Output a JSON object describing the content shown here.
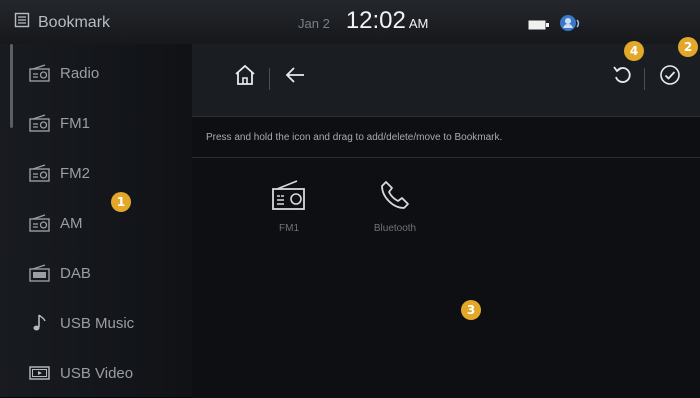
{
  "status_bar": {
    "app_title": "Bookmark",
    "app_icon": "bookmark-icon",
    "date": "Jan 2",
    "time": "12:02",
    "ampm": "AM",
    "icons": [
      "battery-icon",
      "voice-assistant-icon"
    ]
  },
  "sidebar": {
    "items": [
      {
        "label": "Radio",
        "icon": "radio-icon"
      },
      {
        "label": "FM1",
        "icon": "radio-icon"
      },
      {
        "label": "FM2",
        "icon": "radio-icon"
      },
      {
        "label": "AM",
        "icon": "radio-icon"
      },
      {
        "label": "DAB",
        "icon": "dab-icon"
      },
      {
        "label": "USB Music",
        "icon": "music-note-icon"
      },
      {
        "label": "USB Video",
        "icon": "video-icon"
      }
    ]
  },
  "toolbar": {
    "home_icon": "home-icon",
    "back_icon": "back-arrow-icon",
    "reset_icon": "reset-icon",
    "confirm_icon": "check-circle-icon"
  },
  "panel": {
    "instruction": "Press and hold the icon and drag to add/delete/move to Bookmark.",
    "bookmarks": [
      {
        "label": "FM1",
        "icon": "radio-icon"
      },
      {
        "label": "Bluetooth",
        "icon": "phone-icon"
      }
    ]
  },
  "markers": [
    "1",
    "2",
    "3",
    "4"
  ],
  "colors": {
    "marker": "#e3a82a",
    "background": "#050608",
    "sidebar": "#15171b"
  }
}
